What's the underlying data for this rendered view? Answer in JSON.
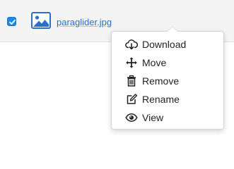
{
  "file_row": {
    "checked": true,
    "file_icon": "image-file-icon",
    "file_name": "paraglider.jpg"
  },
  "context_menu": {
    "items": [
      {
        "label": "Download",
        "icon": "cloud-download-icon"
      },
      {
        "label": "Move",
        "icon": "move-arrows-icon"
      },
      {
        "label": "Remove",
        "icon": "trash-icon"
      },
      {
        "label": "Rename",
        "icon": "edit-icon"
      },
      {
        "label": "View",
        "icon": "eye-icon"
      }
    ]
  },
  "colors": {
    "accent": "#2a6fc9",
    "checkbox": "#1e88e5",
    "row_background": "#f4f4f4"
  }
}
